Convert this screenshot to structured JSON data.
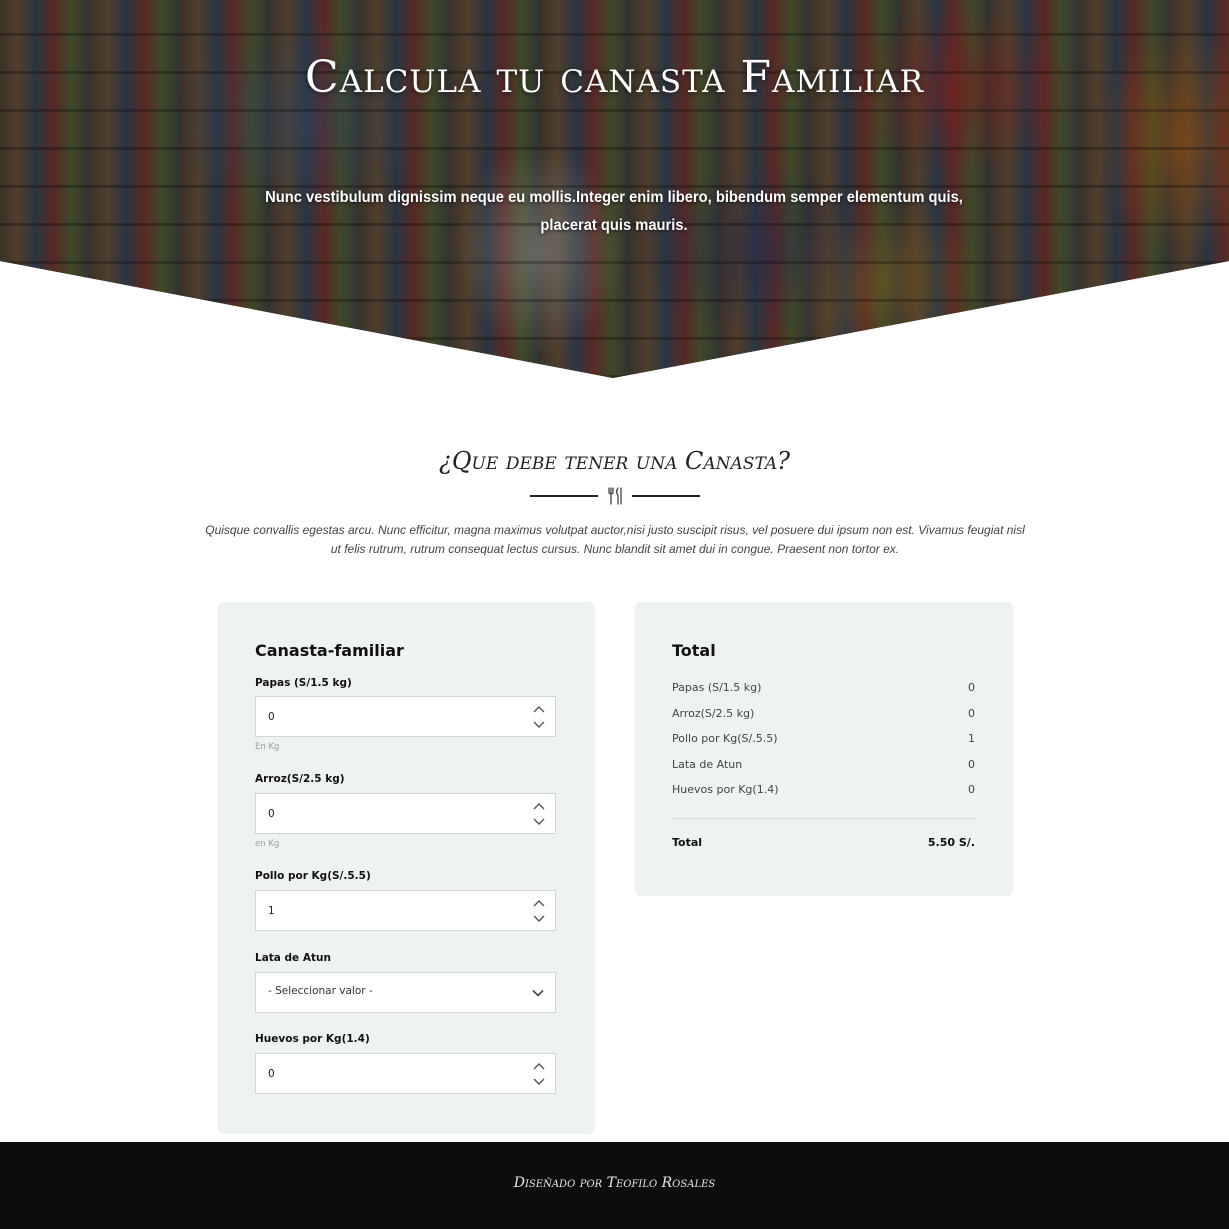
{
  "hero": {
    "title": "Calcula tu canasta Familiar",
    "subtitle": "Nunc vestibulum dignissim neque eu mollis.Integer enim libero, bibendum semper elementum quis, placerat quis mauris."
  },
  "section": {
    "title": "¿Que debe tener una Canasta?",
    "description": "Quisque convallis egestas arcu. Nunc efficitur, magna maximus volutpat auctor,nisi justo suscipit risus, vel posuere dui ipsum non est. Vivamus feugiat nisl  ut felis rutrum, rutrum consequat lectus cursus. Nunc blandit sit amet dui  in congue. Praesent non tortor ex.",
    "divider_icon": "cutlery-icon"
  },
  "form": {
    "title": "Canasta-familiar",
    "fields": [
      {
        "label": "Papas (S/1.5 kg)",
        "value": "0",
        "hint": "En Kg"
      },
      {
        "label": "Arroz(S/2.5 kg)",
        "value": "0",
        "hint": "en Kg"
      },
      {
        "label": "Pollo por Kg(S/.5.5)",
        "value": "1"
      },
      {
        "label": "Lata de Atun",
        "selected": "- Seleccionar valor -"
      },
      {
        "label": "Huevos por Kg(1.4)",
        "value": "0"
      }
    ]
  },
  "total": {
    "title": "Total",
    "rows": [
      {
        "name": "Papas (S/1.5 kg)",
        "qty": "0"
      },
      {
        "name": "Arroz(S/2.5 kg)",
        "qty": "0"
      },
      {
        "name": "Pollo por Kg(S/.5.5)",
        "qty": "1"
      },
      {
        "name": "Lata de Atun",
        "qty": "0"
      },
      {
        "name": "Huevos por Kg(1.4)",
        "qty": "0"
      }
    ],
    "grand_label": "Total",
    "grand_amount": "5.50 S/."
  },
  "footer": {
    "text": "Diseñado por Teofilo Rosales"
  },
  "colors": {
    "card_bg": "#eef2f2",
    "footer_bg": "#0d0d0d",
    "hero_text": "#ffffff"
  }
}
